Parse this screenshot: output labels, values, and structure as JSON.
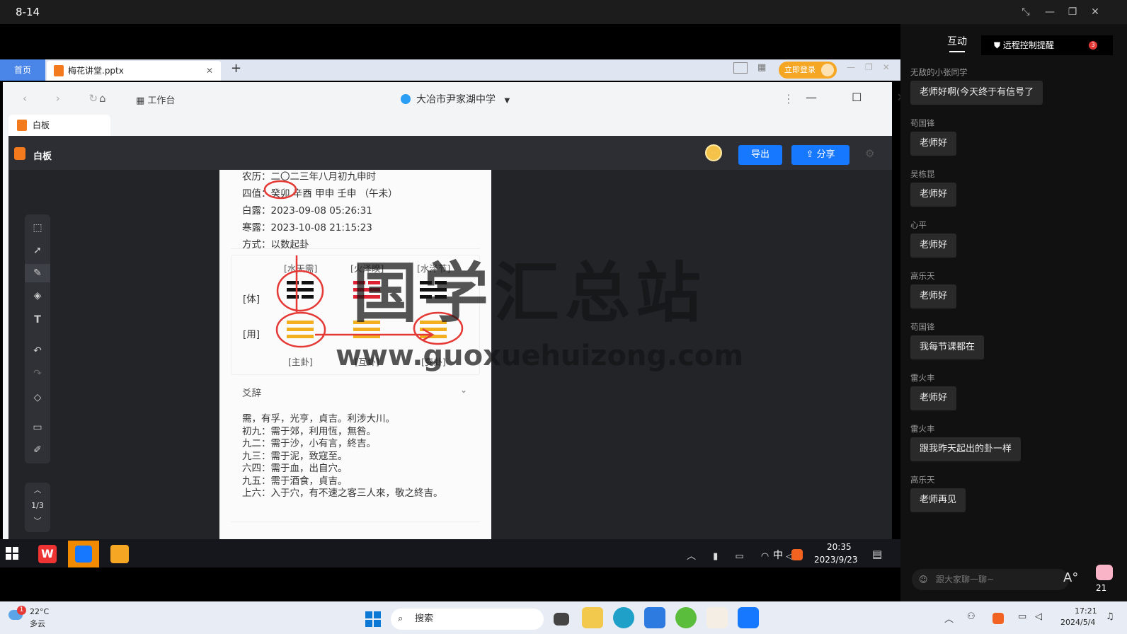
{
  "window": {
    "title": "8-14"
  },
  "wps": {
    "home_tab": "首页",
    "file_tab": "梅花讲堂.pptx",
    "login_label": "立即登录"
  },
  "browser": {
    "workbench_label": "工作台",
    "org_name": "大冶市尹家湖中学",
    "tab_label": "白板"
  },
  "whiteboard": {
    "title": "白板",
    "export_label": "导出",
    "share_label": "分享",
    "page_indicator": "1/3"
  },
  "doc": {
    "lines": [
      "农历：二〇二三年八月初九申时",
      "四值：癸卯 辛酉 甲申 壬申 （午未）",
      "白露：2023-09-08 05:26:31",
      "寒露：2023-10-08 21:15:23",
      "方式：以数起卦"
    ],
    "gua_top_labels": [
      "[水天需]",
      "[火泽睽]",
      "[水泽节]"
    ],
    "row_ti": "[体]",
    "row_yong": "[用]",
    "gua_bottom_labels": [
      "[主卦]",
      "[互卦]",
      "[变卦]"
    ],
    "section_title": "爻辞",
    "yao": [
      "需，有孚，光亨，貞吉。利涉大川。",
      "初九：需于郊，利用恆，無咎。",
      "九二：需于沙，小有言，終吉。",
      "九三：需于泥，致寇至。",
      "六四：需于血，出自穴。",
      "九五：需于酒食，貞吉。",
      "上六：入于穴，有不速之客三人來，敬之終吉。"
    ]
  },
  "watermark": {
    "line1": "国学汇总站",
    "line2": "www.guoxuehuizong.com"
  },
  "inner_taskbar": {
    "time": "20:35",
    "date": "2023/9/23",
    "ime": "中"
  },
  "chat": {
    "tab_label": "互动",
    "remote_label": "远程控制提醒",
    "remote_badge": "3",
    "messages": [
      {
        "name": "无敌的小张同学",
        "text": "老师好啊(今天终于有信号了"
      },
      {
        "name": "苟国锋",
        "text": "老师好"
      },
      {
        "name": "吴栋昆",
        "text": "老师好"
      },
      {
        "name": "心平",
        "text": "老师好"
      },
      {
        "name": "高乐天",
        "text": "老师好"
      },
      {
        "name": "苟国锋",
        "text": "我每节课都在"
      },
      {
        "name": "雷火丰",
        "text": "老师好"
      },
      {
        "name": "雷火丰",
        "text": "跟我昨天起出的卦一样"
      },
      {
        "name": "高乐天",
        "text": "老师再见"
      }
    ],
    "input_placeholder": "跟大家聊一聊~",
    "like_count": "21"
  },
  "taskbar": {
    "weather_temp": "22°C",
    "weather_desc": "多云",
    "weather_badge": "1",
    "search_placeholder": "搜索",
    "ime": "中",
    "time": "17:21",
    "date": "2024/5/4"
  },
  "colors": {
    "accent": "#1677ff",
    "annotation": "#e53935",
    "panel": "#111111"
  }
}
